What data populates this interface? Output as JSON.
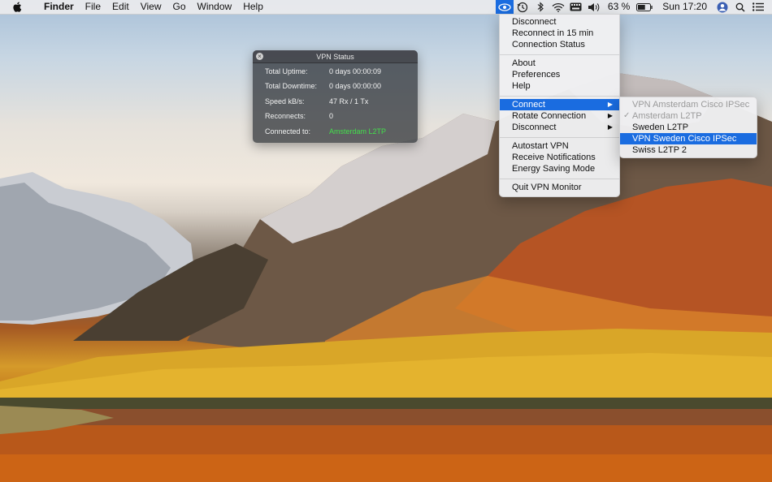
{
  "menubar": {
    "app_name": "Finder",
    "menus": [
      "File",
      "Edit",
      "View",
      "Go",
      "Window",
      "Help"
    ],
    "battery_percent": "63 %",
    "clock": "Sun 17:20",
    "status_icons": [
      "vpn-eye-icon",
      "time-machine-icon",
      "bluetooth-icon",
      "wifi-icon",
      "keyboard-icon",
      "volume-icon",
      "battery-icon",
      "user-icon",
      "spotlight-icon",
      "notification-center-icon"
    ]
  },
  "vpn_status": {
    "title": "VPN Status",
    "rows": [
      {
        "label": "Total Uptime:",
        "value": "0 days 00:00:09"
      },
      {
        "label": "Total Downtime:",
        "value": "0 days 00:00:00"
      },
      {
        "label": "Speed kB/s:",
        "value": "47 Rx / 1 Tx"
      },
      {
        "label": "Reconnects:",
        "value": "0"
      },
      {
        "label": "Connected to:",
        "value": "Amsterdam L2TP"
      }
    ],
    "connected_color": "#43e04b"
  },
  "vpn_menu": {
    "group1": [
      "Disconnect",
      "Reconnect in 15 min",
      "Connection Status"
    ],
    "group2": [
      "About",
      "Preferences",
      "Help"
    ],
    "group3": [
      "Connect",
      "Rotate Connection",
      "Disconnect"
    ],
    "group4": [
      "Autostart VPN",
      "Receive Notifications",
      "Energy Saving Mode"
    ],
    "group5": [
      "Quit VPN Monitor"
    ],
    "submenu_arrow": "▶"
  },
  "connect_submenu": {
    "items": [
      "VPN Amsterdam Cisco IPSec",
      "Amsterdam L2TP",
      "Sweden L2TP",
      "VPN Sweden Cisco IPSec",
      "Swiss L2TP 2"
    ],
    "checkmark": "✓"
  },
  "colors": {
    "selection": "#1a6ce0"
  }
}
